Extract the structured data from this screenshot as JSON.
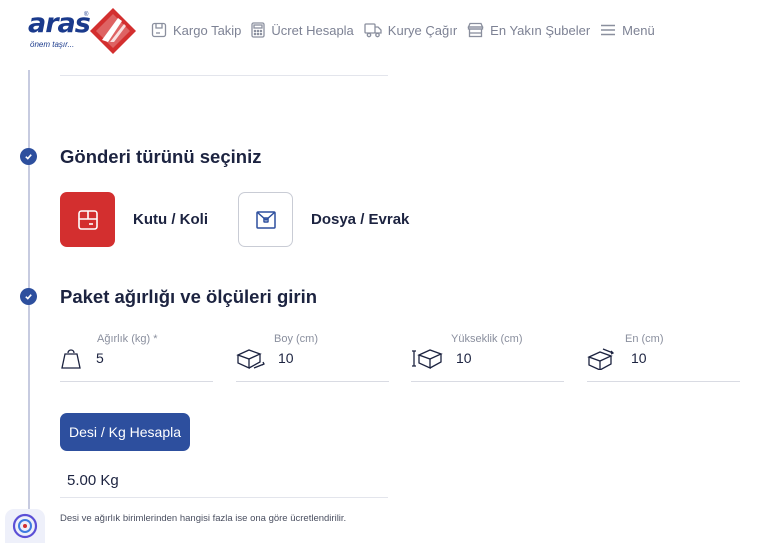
{
  "brand": {
    "logo_text": "aras",
    "reg_mark": "®",
    "tagline": "önem taşır...",
    "color_blue": "#1a3a8c",
    "color_red": "#d32f2f"
  },
  "nav": {
    "items": [
      {
        "label": "Kargo Takip",
        "icon": "package-icon"
      },
      {
        "label": "Ücret Hesapla",
        "icon": "calculator-icon"
      },
      {
        "label": "Kurye Çağır",
        "icon": "truck-icon"
      },
      {
        "label": "En Yakın Şubeler",
        "icon": "store-icon"
      },
      {
        "label": "Menü",
        "icon": "menu-icon"
      }
    ]
  },
  "shipment_type": {
    "title": "Gönderi türünü seçiniz",
    "options": [
      {
        "label": "Kutu / Koli",
        "icon": "box-icon",
        "selected": true
      },
      {
        "label": "Dosya / Evrak",
        "icon": "envelope-icon",
        "selected": false
      }
    ]
  },
  "package": {
    "title": "Paket ağırlığı ve ölçüleri girin",
    "fields": [
      {
        "label": "Ağırlık (kg) *",
        "value": "5",
        "icon": "weight-icon"
      },
      {
        "label": "Boy (cm)",
        "value": "10",
        "icon": "box-length-icon"
      },
      {
        "label": "Yükseklik (cm)",
        "value": "10",
        "icon": "box-height-icon"
      },
      {
        "label": "En (cm)",
        "value": "10",
        "icon": "box-width-icon"
      }
    ],
    "calc_button": "Desi / Kg Hesapla",
    "result": "5.00 Kg",
    "note": "Desi ve ağırlık birimlerinden hangisi fazla ise ona göre ücretlendirilir."
  },
  "colors": {
    "primary": "#2d4f9e",
    "text_dark": "#1c2340",
    "text_muted": "#7d8294"
  }
}
